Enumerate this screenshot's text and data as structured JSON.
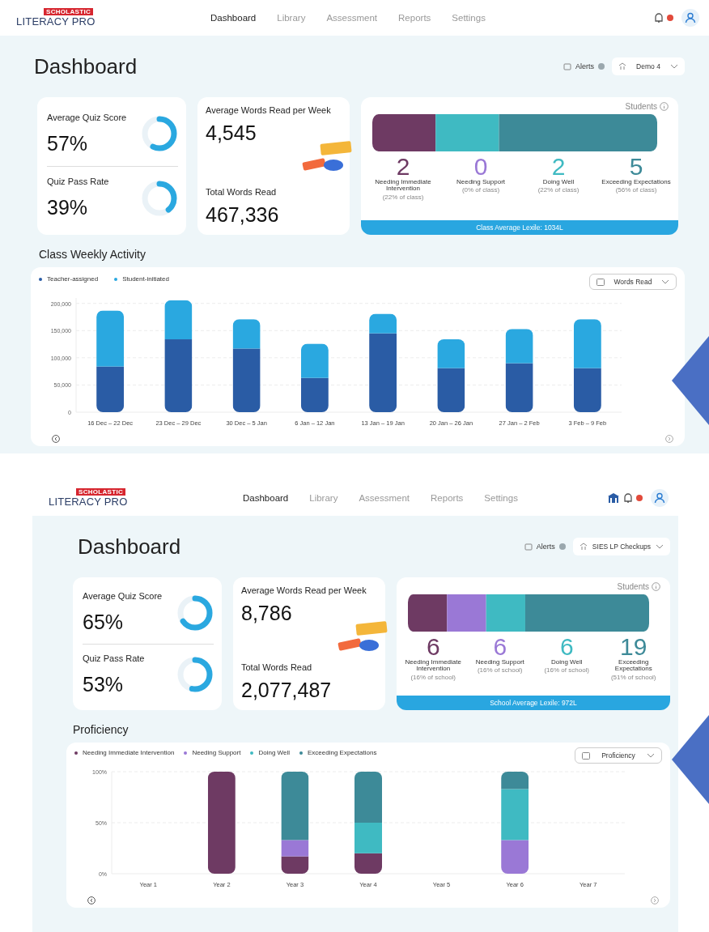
{
  "screens": [
    {
      "nav": {
        "brand": "SCHOLASTIC",
        "product": "LITERACY PRO",
        "items": [
          {
            "label": "Dashboard",
            "selected": true
          },
          {
            "label": "Library",
            "selected": false
          },
          {
            "label": "Assessment",
            "selected": false
          },
          {
            "label": "Reports",
            "selected": false
          },
          {
            "label": "Settings",
            "selected": false
          }
        ]
      },
      "header_icons": [
        {
          "kind": "bell"
        }
      ],
      "title": "Dashboard",
      "alerts_label": "Alerts",
      "group_select": "Demo 4",
      "quiz": [
        {
          "label": "Average Quiz Score",
          "value": "57%",
          "level": 0.57
        },
        {
          "label": "Quiz Pass Rate",
          "value": "39%",
          "level": 0.39
        }
      ],
      "words": [
        {
          "label": "Average Words Read per Week",
          "value": "4,545"
        },
        {
          "label": "Total Words Read",
          "value": "467,336"
        }
      ],
      "students": {
        "title": "Students",
        "groups": [
          {
            "count": "2",
            "label": "Needing Immediate Intervention",
            "share": "(22% of class)",
            "color": "#6e3a63"
          },
          {
            "count": "0",
            "label": "Needing Support",
            "share": "(0% of class)",
            "color": "#9a78d6"
          },
          {
            "count": "2",
            "label": "Doing Well",
            "share": "(22% of class)",
            "color": "#3fbac2"
          },
          {
            "count": "5",
            "label": "Exceeding Expectations",
            "share": "(56% of class)",
            "color": "#3d8a98"
          }
        ],
        "lexile": "Class Average Lexile: 1034L"
      },
      "section_title": "Class Weekly Activity",
      "metric_select": "Words Read",
      "chart_data": {
        "type": "bar",
        "stacked": true,
        "categories": [
          "16 Dec – 22 Dec",
          "23 Dec – 29 Dec",
          "30 Dec – 5 Jan",
          "6 Jan – 12 Jan",
          "13 Jan – 19 Jan",
          "20 Jan – 26 Jan",
          "27 Jan – 2 Feb",
          "3 Feb – 9 Feb"
        ],
        "series": [
          {
            "name": "Teacher-assigned",
            "color": "#2a5ca5",
            "values": [
              84000,
              134000,
              117000,
              63000,
              145000,
              81000,
              90000,
              81000
            ]
          },
          {
            "name": "Student-initiated",
            "color": "#2aa8e0",
            "values": [
              103000,
              72000,
              54000,
              63000,
              36000,
              53000,
              63000,
              90000
            ]
          }
        ],
        "ylim": [
          0,
          210000
        ],
        "grid": true,
        "yticks": [
          {
            "value": 0,
            "label": "0"
          },
          {
            "value": 50000,
            "label": "50,000"
          },
          {
            "value": 100000,
            "label": "100,000"
          },
          {
            "value": 150000,
            "label": "150,000"
          },
          {
            "value": 200000,
            "label": "200,000"
          }
        ]
      }
    },
    {
      "nav": {
        "brand": "SCHOLASTIC",
        "product": "LITERACY PRO",
        "items": [
          {
            "label": "Dashboard",
            "selected": true
          },
          {
            "label": "Library",
            "selected": false
          },
          {
            "label": "Assessment",
            "selected": false
          },
          {
            "label": "Reports",
            "selected": false
          },
          {
            "label": "Settings",
            "selected": false
          }
        ]
      },
      "header_icons": [
        {
          "kind": "school"
        },
        {
          "kind": "bell"
        }
      ],
      "title": "Dashboard",
      "alerts_label": "Alerts",
      "group_select": "SIES LP Checkups",
      "quiz": [
        {
          "label": "Average Quiz Score",
          "value": "65%",
          "level": 0.65
        },
        {
          "label": "Quiz Pass Rate",
          "value": "53%",
          "level": 0.53
        }
      ],
      "words": [
        {
          "label": "Average Words Read per Week",
          "value": "8,786"
        },
        {
          "label": "Total Words Read",
          "value": "2,077,487"
        }
      ],
      "students": {
        "title": "Students",
        "groups": [
          {
            "count": "6",
            "label": "Needing Immediate Intervention",
            "share": "(16% of school)",
            "color": "#6e3a63"
          },
          {
            "count": "6",
            "label": "Needing Support",
            "share": "(16% of school)",
            "color": "#9a78d6"
          },
          {
            "count": "6",
            "label": "Doing Well",
            "share": "(16% of school)",
            "color": "#3fbac2"
          },
          {
            "count": "19",
            "label": "Exceeding Expectations",
            "share": "(51% of school)",
            "color": "#3d8a98"
          }
        ],
        "lexile": "School Average Lexile: 972L"
      },
      "section_title": "Proficiency",
      "metric_select": "Proficiency",
      "chart_data": {
        "type": "bar",
        "stacked": true,
        "categories": [
          "Year 1",
          "Year 2",
          "Year 3",
          "Year 4",
          "Year 5",
          "Year 6",
          "Year 7"
        ],
        "series": [
          {
            "name": "Needing Immediate Intervention",
            "color": "#6e3a63",
            "values": [
              null,
              100,
              17,
              20,
              null,
              0,
              null
            ]
          },
          {
            "name": "Needing Support",
            "color": "#9a78d6",
            "values": [
              null,
              0,
              16,
              0,
              null,
              33,
              null
            ]
          },
          {
            "name": "Doing Well",
            "color": "#3fbac2",
            "values": [
              null,
              0,
              0,
              30,
              null,
              50,
              null
            ]
          },
          {
            "name": "Exceeding Expectations",
            "color": "#3d8a98",
            "values": [
              null,
              0,
              67,
              50,
              null,
              17,
              null
            ]
          }
        ],
        "ylim": [
          0,
          100
        ],
        "grid": true,
        "yticks": [
          {
            "value": 0,
            "label": "0%"
          },
          {
            "value": 50,
            "label": "50%"
          },
          {
            "value": 100,
            "label": "100%"
          }
        ]
      }
    }
  ]
}
